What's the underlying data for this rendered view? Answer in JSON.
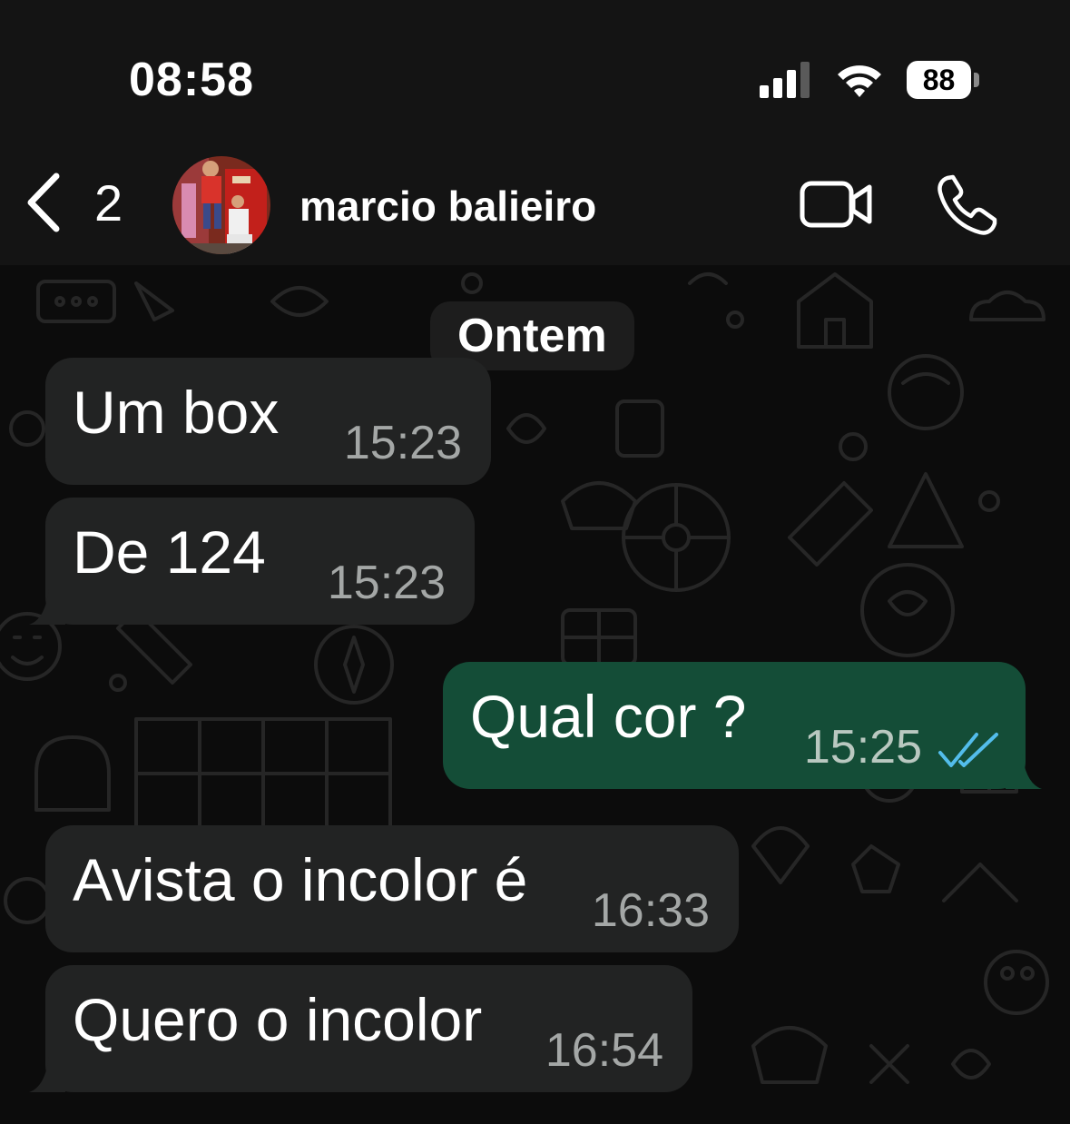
{
  "status_bar": {
    "time": "08:58",
    "battery_level": "88",
    "icons": [
      "signal-icon",
      "wifi-icon",
      "battery-icon"
    ]
  },
  "header": {
    "back_icon": "chevron-left-icon",
    "unread_count": "2",
    "contact_name": "marcio balieiro",
    "actions": [
      "video-camera-icon",
      "phone-icon"
    ]
  },
  "chat": {
    "date_separator": "Ontem",
    "messages": [
      {
        "direction": "incoming",
        "text": "Um box",
        "time": "15:23"
      },
      {
        "direction": "incoming",
        "text": "De 124",
        "time": "15:23"
      },
      {
        "direction": "outgoing",
        "text": "Qual cor ?",
        "time": "15:25",
        "status": "read"
      },
      {
        "direction": "incoming",
        "text": "Avista o incolor é",
        "time": "16:33"
      },
      {
        "direction": "incoming",
        "text": "Quero o incolor",
        "time": "16:54"
      }
    ]
  },
  "colors": {
    "background": "#0b0b0b",
    "header": "#141414",
    "incoming_bubble": "#222323",
    "outgoing_bubble": "#144d37",
    "read_ticks": "#53bdeb",
    "timestamp": "#a4a7a6"
  }
}
